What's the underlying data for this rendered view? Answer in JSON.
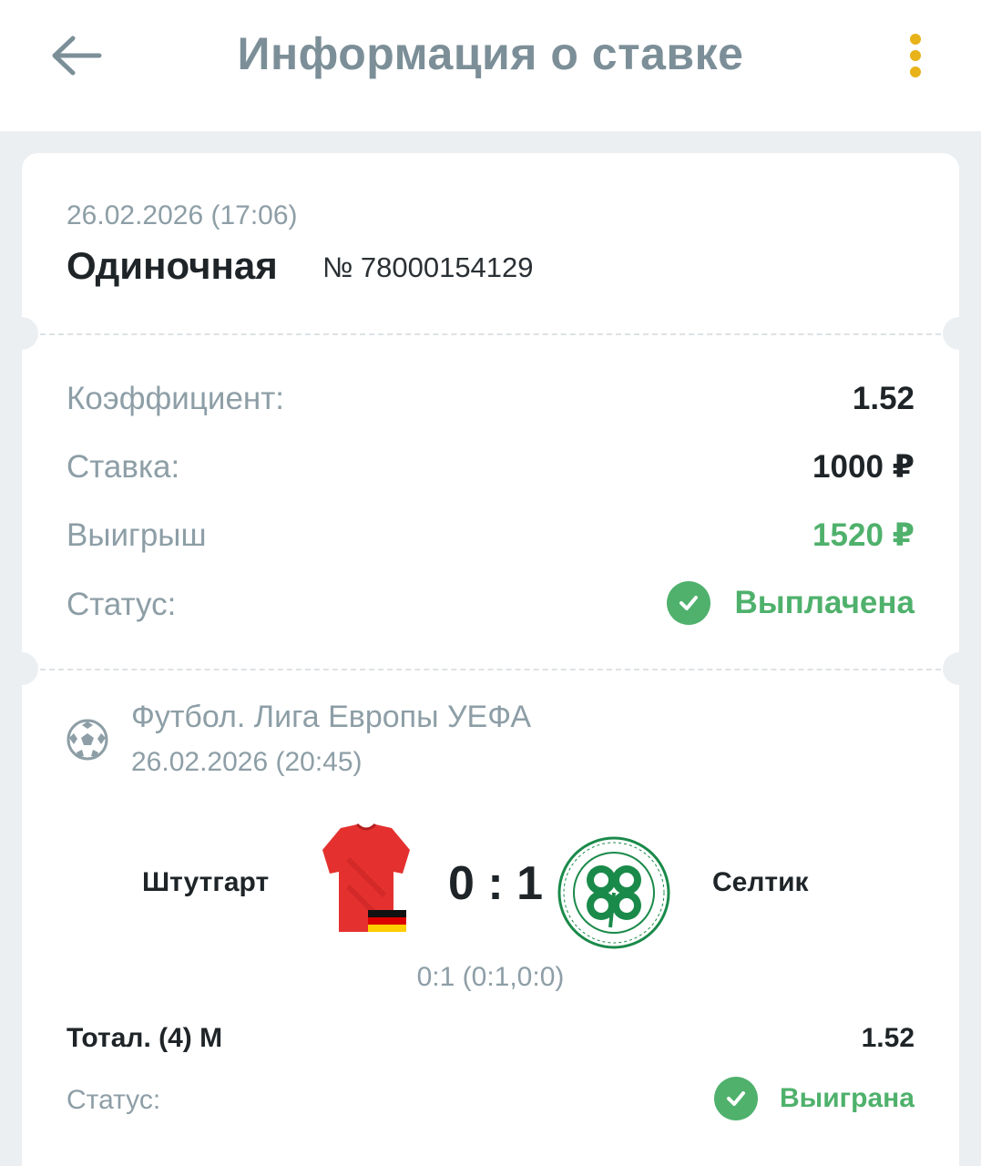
{
  "header": {
    "back_icon": "arrow-left-icon",
    "title": "Информация о ставке",
    "menu_icon": "more-vertical-icon",
    "accent_color": "#e8b318"
  },
  "bet": {
    "datetime": "26.02.2026 (17:06)",
    "type": "Одиночная",
    "number": "№ 78000154129"
  },
  "summary": {
    "rows": [
      {
        "label": "Коэффициент:",
        "value": "1.52"
      },
      {
        "label": "Ставка:",
        "value": "1000 ₽"
      },
      {
        "label": "Выигрыш",
        "value": "1520 ₽"
      },
      {
        "label": "Статус:",
        "value": "Выплачена"
      }
    ],
    "status_icon": "check-circle-icon",
    "win_color": "#4fb16c"
  },
  "event": {
    "sport_icon": "football-icon",
    "league": "Футбол. Лига Европы УЕФА",
    "datetime": "26.02.2026 (20:45)",
    "home_team": "Штутгарт",
    "away_team": "Селтик",
    "score": "0 : 1",
    "periods": "0:1 (0:1,0:0)",
    "home_logo": "red-jersey-germany-flag-icon",
    "away_logo": "celtic-crest-icon",
    "market": "Тотал. (4) М",
    "market_odds": "1.52",
    "status_label": "Статус:",
    "status": "Выиграна"
  }
}
